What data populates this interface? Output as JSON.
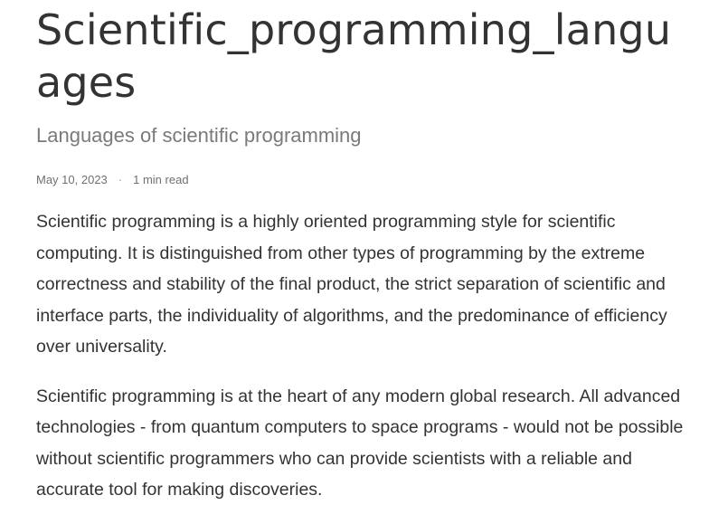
{
  "article": {
    "title": "Scientific_programming_languages",
    "subtitle": "Languages of scientific programming",
    "meta": {
      "date": "May 10, 2023",
      "separator": "·",
      "read_time": "1 min read"
    },
    "paragraphs": [
      "Scientific programming is a highly oriented programming style for scientific computing. It is distinguished from other types of programming by the extreme correctness and stability of the final product, the strict separation of scientific and interface parts, the individuality of algorithms, and the predominance of efficiency over universality.",
      "Scientific programming is at the heart of any modern global research. All advanced technologies - from quantum computers to space programs - would not be possible without scientific programmers who can provide scientists with a reliable and accurate tool for making discoveries."
    ]
  }
}
